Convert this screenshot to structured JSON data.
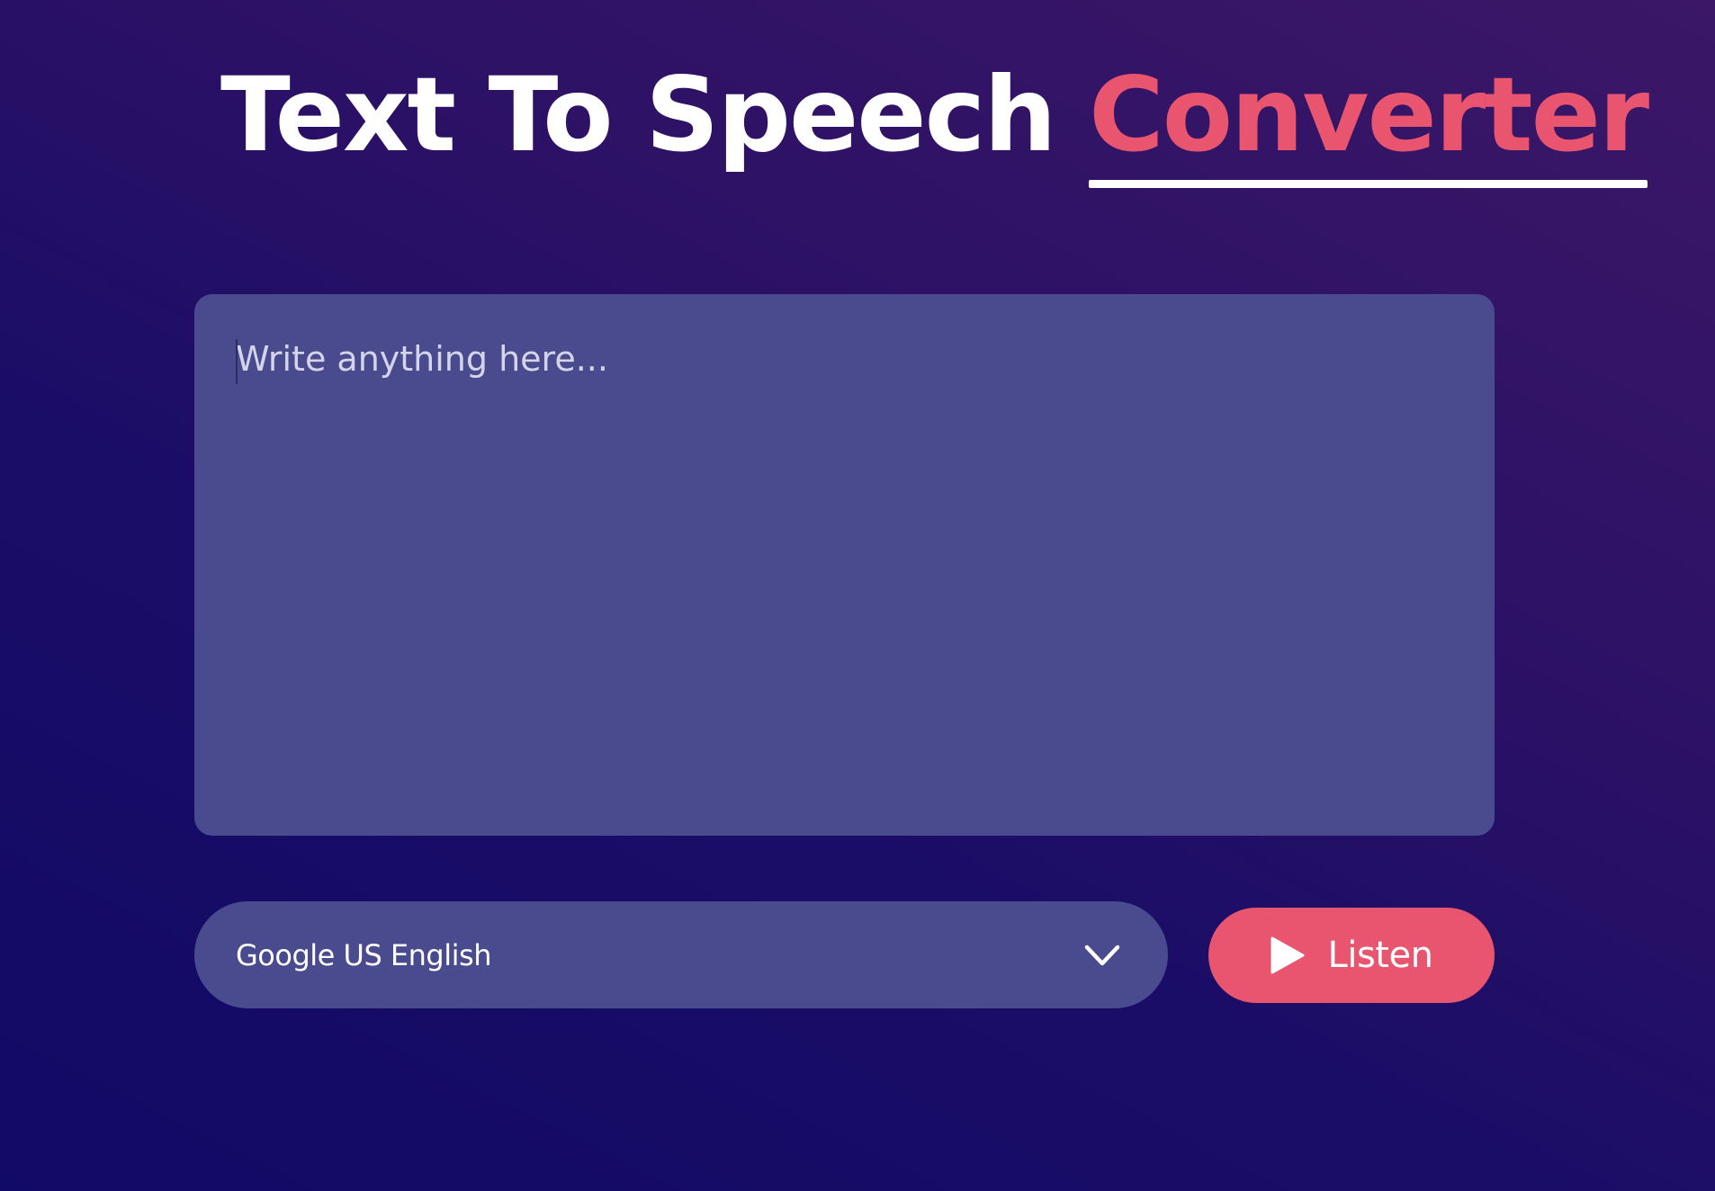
{
  "header": {
    "title_main": "Text To Speech",
    "title_accent": "Converter"
  },
  "editor": {
    "placeholder": "Write anything here...",
    "value": ""
  },
  "voice_select": {
    "selected": "Google US English",
    "icon": "chevron-down-icon"
  },
  "listen_button": {
    "label": "Listen",
    "icon": "play-icon"
  },
  "colors": {
    "background_start": "#110a66",
    "background_end": "#3c1767",
    "panel": "#494b8e",
    "accent": "#e9546f",
    "text": "#ffffff"
  }
}
